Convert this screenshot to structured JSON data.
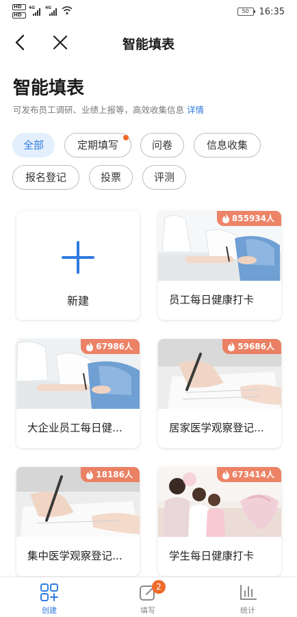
{
  "status_bar": {
    "network_a": "4G",
    "network_b": "4G",
    "battery": "50",
    "time": "16:35"
  },
  "nav": {
    "title": "智能填表"
  },
  "page": {
    "title": "智能填表",
    "subtitle": "可发布员工调研、业绩上报等，高效收集信息",
    "detail_link": "详情"
  },
  "filters": [
    {
      "label": "全部",
      "active": true
    },
    {
      "label": "定期填写",
      "has_dot": true
    },
    {
      "label": "问卷"
    },
    {
      "label": "信息收集"
    },
    {
      "label": "报名登记"
    },
    {
      "label": "投票"
    },
    {
      "label": "评测"
    }
  ],
  "new_card": {
    "label": "新建"
  },
  "templates": [
    {
      "label": "员工每日健康打卡",
      "count": "855934人",
      "image": "doctor-consultation-photo"
    },
    {
      "label": "大企业员工每日健...",
      "count": "67986人",
      "image": "doctor-consultation-photo"
    },
    {
      "label": "居家医学观察登记...",
      "count": "59686人",
      "image": "hand-writing-photo"
    },
    {
      "label": "集中医学观察登记...",
      "count": "18186人",
      "image": "hand-writing-photo"
    },
    {
      "label": "学生每日健康打卡",
      "count": "673414人",
      "image": "family-photo"
    }
  ],
  "tabs": [
    {
      "label": "创建",
      "icon": "create-grid-icon",
      "active": true
    },
    {
      "label": "填写",
      "icon": "edit-icon",
      "badge": "2"
    },
    {
      "label": "统计",
      "icon": "bar-chart-icon"
    }
  ],
  "colors": {
    "accent": "#2f7be0",
    "badge": "#ec785a",
    "dot": "#f06b2b"
  }
}
